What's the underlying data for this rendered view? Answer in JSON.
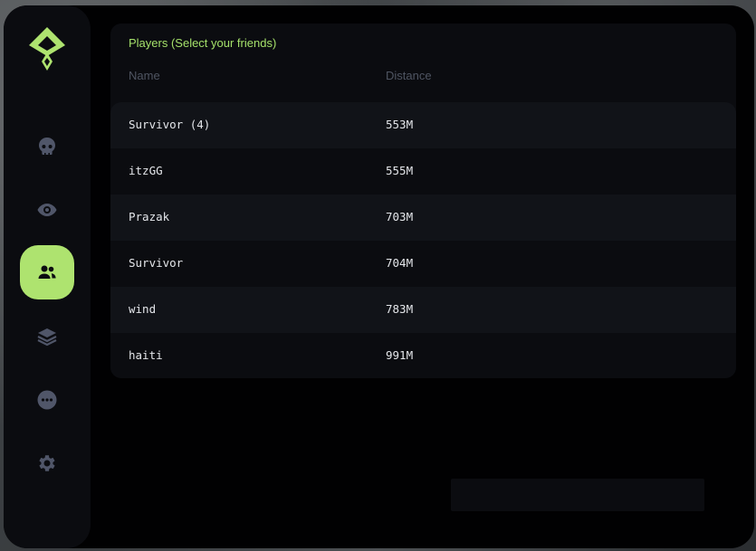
{
  "sidebar": {
    "items": [
      {
        "icon": "skull-icon",
        "active": false
      },
      {
        "icon": "eye-icon",
        "active": false
      },
      {
        "icon": "users-icon",
        "active": true
      },
      {
        "icon": "layers-icon",
        "active": false
      },
      {
        "icon": "more-dots-icon",
        "active": false
      },
      {
        "icon": "gear-icon",
        "active": false
      }
    ]
  },
  "players": {
    "title": "Players (Select your friends)",
    "columns": {
      "name": "Name",
      "distance": "Distance"
    },
    "rows": [
      {
        "name": "Survivor (4)",
        "distance": "553M"
      },
      {
        "name": "itzGG",
        "distance": "555M"
      },
      {
        "name": "Prazak",
        "distance": "703M"
      },
      {
        "name": "Survivor",
        "distance": "704M"
      },
      {
        "name": "wind",
        "distance": "783M"
      },
      {
        "name": "haiti",
        "distance": "991M"
      }
    ]
  },
  "colors": {
    "accent": "#aee36f",
    "title": "#a4e06a",
    "icon": "#505669",
    "background": "#010102",
    "panel": "#0b0c10"
  }
}
